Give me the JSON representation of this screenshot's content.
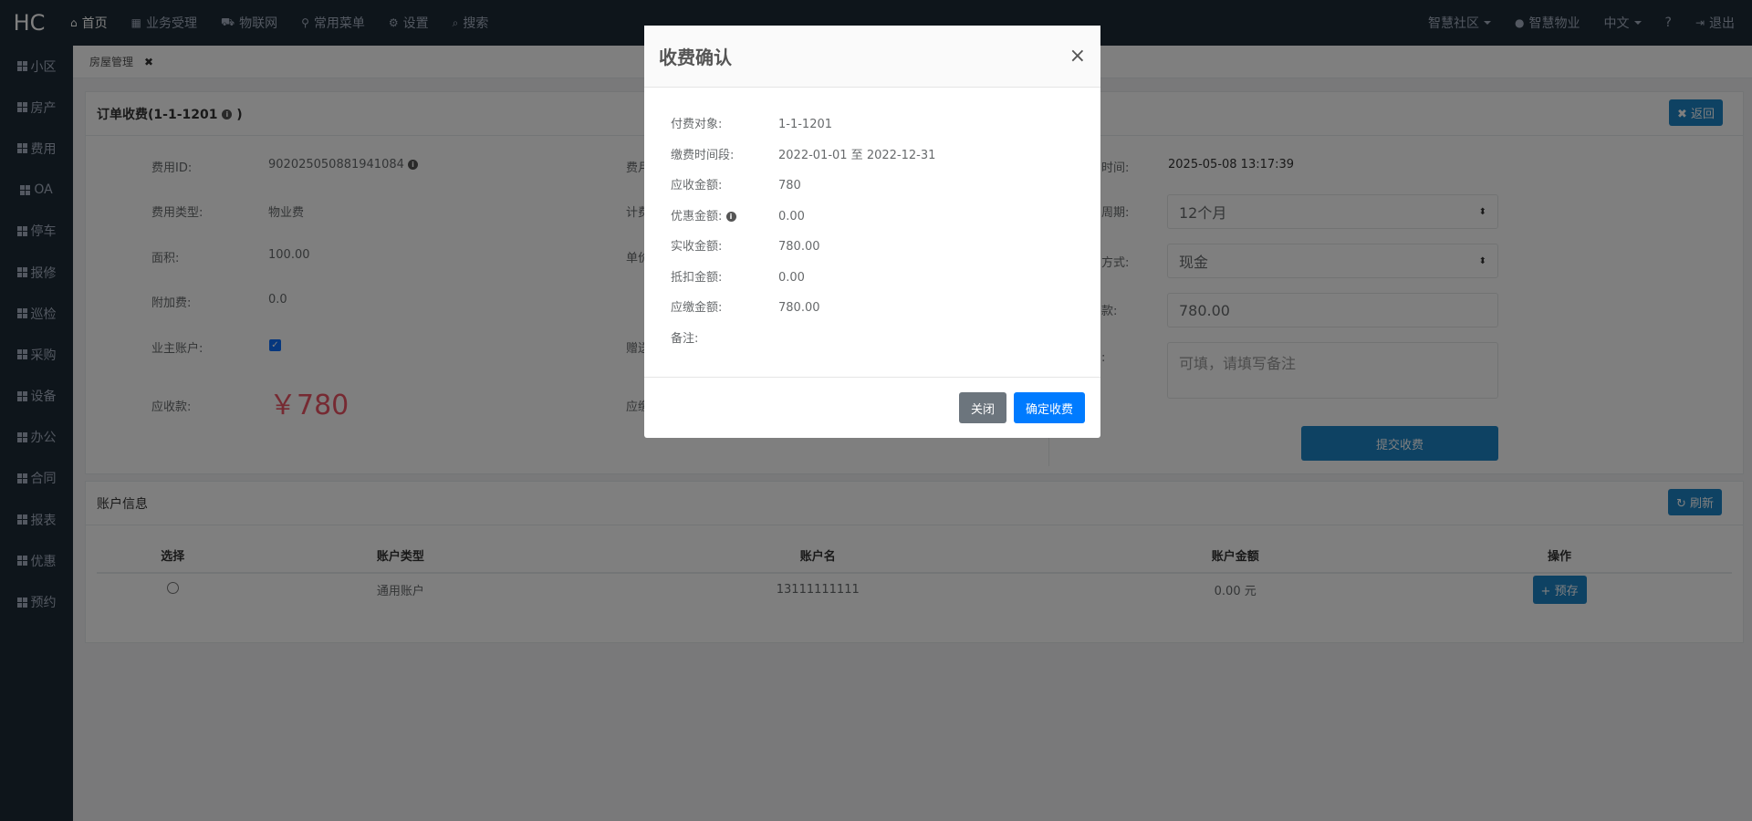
{
  "nav": {
    "logo": "HC",
    "items": [
      {
        "icon": "home-icon",
        "glyph": "⌂",
        "label": "首页"
      },
      {
        "icon": "building-icon",
        "glyph": "▦",
        "label": "业务受理"
      },
      {
        "icon": "car-icon",
        "glyph": "⛟",
        "label": "物联网"
      },
      {
        "icon": "sitemap-icon",
        "glyph": "⚲",
        "label": "常用菜单"
      },
      {
        "icon": "gear-icon",
        "glyph": "⚙",
        "label": "设置"
      },
      {
        "icon": "search-icon",
        "glyph": "⌕",
        "label": "搜索"
      }
    ],
    "right": {
      "community": "智慧社区",
      "user": "智慧物业",
      "language": "中文",
      "help": "?",
      "logout": "退出"
    }
  },
  "sidebar": {
    "items": [
      "小区",
      "房产",
      "费用",
      "OA",
      "停车",
      "报修",
      "巡检",
      "采购",
      "设备",
      "办公",
      "合同",
      "报表",
      "优惠",
      "预约"
    ]
  },
  "tabs": {
    "current": "房屋管理",
    "close": "✖"
  },
  "order": {
    "title": "订单收费(1-1-1201",
    "title_suffix": ")",
    "back_label": "返回",
    "fee_id_label": "费用ID:",
    "fee_id": "902025050881941084",
    "fee_type_label": "费用类型:",
    "fee_type": "物业费",
    "area_label": "面积:",
    "area": "100.00",
    "surcharge_label": "附加费:",
    "surcharge": "0.0",
    "owner_account_label": "业主账户:",
    "receivable_label": "应收款:",
    "receivable_amount": "￥780",
    "mid_labels": [
      "费月",
      "计费",
      "单价",
      "赠送",
      "应缴"
    ],
    "time_label": "时间:",
    "time_value": "2025-05-08 13:17:39",
    "period_label": "周期:",
    "period_value": "12个月",
    "method_label": "方式:",
    "method_value": "现金",
    "amount_label": "款:",
    "amount_value": "780.00",
    "remark_label": ":",
    "remark_placeholder": "可填，请填写备注",
    "submit_label": "提交收费"
  },
  "account": {
    "title": "账户信息",
    "refresh_label": "刷新",
    "headers": [
      "选择",
      "账户类型",
      "账户名",
      "账户金额",
      "操作"
    ],
    "rows": [
      {
        "type": "通用账户",
        "name": "13111111111",
        "amount": "0.00 元",
        "action": "预存"
      }
    ]
  },
  "modal": {
    "title": "收费确认",
    "close_glyph": "×",
    "rows": [
      {
        "label": "付费对象:",
        "value": "1-1-1201"
      },
      {
        "label": "缴费时间段:",
        "value": "2022-01-01 至 2022-12-31"
      },
      {
        "label": "应收金额:",
        "value": "780"
      },
      {
        "label": "优惠金额:",
        "value": "0.00"
      },
      {
        "label": "实收金额:",
        "value": "780.00"
      },
      {
        "label": "抵扣金额:",
        "value": "0.00"
      },
      {
        "label": "应缴金额:",
        "value": "780.00"
      },
      {
        "label": "备注:",
        "value": ""
      }
    ],
    "cancel_label": "关闭",
    "confirm_label": "确定收费"
  }
}
